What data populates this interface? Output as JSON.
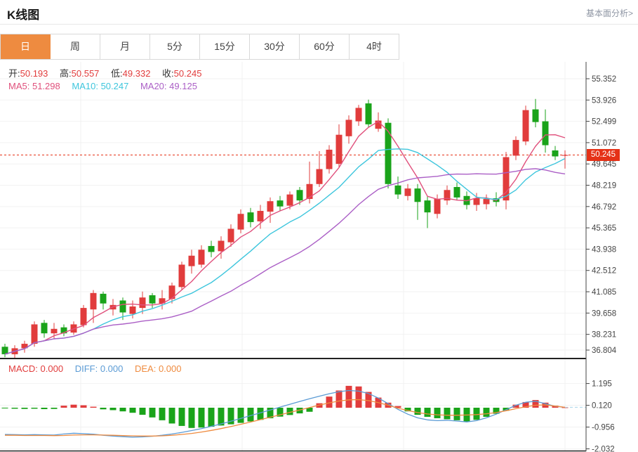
{
  "header": {
    "title": "K线图",
    "link": "基本面分析>"
  },
  "tabs": {
    "items": [
      "日",
      "周",
      "月",
      "5分",
      "15分",
      "30分",
      "60分",
      "4时"
    ],
    "active_index": 0
  },
  "legend": {
    "ohlc": [
      {
        "label": "开:",
        "value": "50.193"
      },
      {
        "label": "高:",
        "value": "50.557"
      },
      {
        "label": "低:",
        "value": "49.332"
      },
      {
        "label": "收:",
        "value": "50.245"
      }
    ],
    "ma": [
      {
        "label": "MA5:",
        "value": "51.298",
        "color": "#e0507c"
      },
      {
        "label": "MA10:",
        "value": "50.247",
        "color": "#3ec6dd"
      },
      {
        "label": "MA20:",
        "value": "49.125",
        "color": "#ab5fc6"
      }
    ],
    "macd": [
      {
        "label": "MACD:",
        "value": "0.000",
        "color": "#e13c3c"
      },
      {
        "label": "DIFF:",
        "value": "0.000",
        "color": "#5b9bd5"
      },
      {
        "label": "DEA:",
        "value": "0.000",
        "color": "#ef8b3f"
      }
    ]
  },
  "colors": {
    "accent": "#ee8b40",
    "up": "#e13c3c",
    "down": "#1aa31a",
    "ma5": "#e0507c",
    "ma10": "#3ec6dd",
    "ma20": "#ab5fc6",
    "diff": "#5b9bd5",
    "dea": "#ef8b3f",
    "last_price_bg": "#e53117",
    "dotted_line": "#e53117",
    "grid": "#f0f0f0",
    "axis": "#444444",
    "pane_divider": "#222222",
    "tick_text": "#444444"
  },
  "chart_data": {
    "type": "candlestick",
    "title": "K线图",
    "panes": [
      "price-with-ma",
      "macd"
    ],
    "legend_position": "top-left",
    "grid": true,
    "main": {
      "y_ticks": [
        "55.352",
        "53.926",
        "52.499",
        "51.072",
        "49.645",
        "48.219",
        "46.792",
        "45.365",
        "43.938",
        "42.512",
        "41.085",
        "39.658",
        "38.231",
        "36.804"
      ],
      "ylim": [
        36.6,
        55.4
      ],
      "last_price": 50.245,
      "last_price_label": "50.245",
      "ma_periods": [
        5,
        10,
        20
      ],
      "candles_format": [
        "open",
        "high",
        "low",
        "close"
      ],
      "candles": [
        [
          37.4,
          37.6,
          36.7,
          36.9
        ],
        [
          36.9,
          37.5,
          36.65,
          37.3
        ],
        [
          37.3,
          37.8,
          37.0,
          37.6
        ],
        [
          37.6,
          39.1,
          37.4,
          38.9
        ],
        [
          39.0,
          39.2,
          38.0,
          38.3
        ],
        [
          38.3,
          39.0,
          37.9,
          38.6
        ],
        [
          38.7,
          38.9,
          38.1,
          38.3
        ],
        [
          38.35,
          39.1,
          38.2,
          38.9
        ],
        [
          38.85,
          40.2,
          38.7,
          40.0
        ],
        [
          39.9,
          41.2,
          39.0,
          41.0
        ],
        [
          40.95,
          41.1,
          39.9,
          40.3
        ],
        [
          39.9,
          40.6,
          39.5,
          40.2
        ],
        [
          40.5,
          40.7,
          39.2,
          39.7
        ],
        [
          39.6,
          40.5,
          39.3,
          40.1
        ],
        [
          40.0,
          41.1,
          39.6,
          40.7
        ],
        [
          40.85,
          41.0,
          40.0,
          40.3
        ],
        [
          40.3,
          41.2,
          39.9,
          40.65
        ],
        [
          40.6,
          41.7,
          40.3,
          41.5
        ],
        [
          41.4,
          43.1,
          41.2,
          42.9
        ],
        [
          42.8,
          43.9,
          42.3,
          43.5
        ],
        [
          42.9,
          44.2,
          42.7,
          43.9
        ],
        [
          44.15,
          44.5,
          43.4,
          43.75
        ],
        [
          43.8,
          44.8,
          43.3,
          44.5
        ],
        [
          44.4,
          45.6,
          44.1,
          45.3
        ],
        [
          45.25,
          46.6,
          45.0,
          46.3
        ],
        [
          46.4,
          46.7,
          45.4,
          45.75
        ],
        [
          45.8,
          46.9,
          45.3,
          46.5
        ],
        [
          46.45,
          47.4,
          45.7,
          47.15
        ],
        [
          47.2,
          47.5,
          46.5,
          46.8
        ],
        [
          46.85,
          47.8,
          46.6,
          47.6
        ],
        [
          47.9,
          48.1,
          46.9,
          47.2
        ],
        [
          47.3,
          49.8,
          47.0,
          48.3
        ],
        [
          48.3,
          50.5,
          48.1,
          49.3
        ],
        [
          49.3,
          50.9,
          49.0,
          50.6
        ],
        [
          49.65,
          52.3,
          49.4,
          51.6
        ],
        [
          51.5,
          52.9,
          51.0,
          52.6
        ],
        [
          52.5,
          53.6,
          52.2,
          53.4
        ],
        [
          53.7,
          53.95,
          52.1,
          52.3
        ],
        [
          52.0,
          53.1,
          51.8,
          52.55
        ],
        [
          52.4,
          52.7,
          48.0,
          48.3
        ],
        [
          48.2,
          48.8,
          47.3,
          47.6
        ],
        [
          47.5,
          48.3,
          47.2,
          48.0
        ],
        [
          48.0,
          48.3,
          45.9,
          47.1
        ],
        [
          47.2,
          47.5,
          45.35,
          46.4
        ],
        [
          46.3,
          47.6,
          46.0,
          47.3
        ],
        [
          47.2,
          48.2,
          46.9,
          47.9
        ],
        [
          48.1,
          48.4,
          47.2,
          47.4
        ],
        [
          47.5,
          47.8,
          46.6,
          46.9
        ],
        [
          46.9,
          47.7,
          46.5,
          47.35
        ],
        [
          46.95,
          47.6,
          46.6,
          47.3
        ],
        [
          47.35,
          47.75,
          46.8,
          47.1
        ],
        [
          47.2,
          50.45,
          46.6,
          50.1
        ],
        [
          50.2,
          51.5,
          49.9,
          51.25
        ],
        [
          51.15,
          53.55,
          50.9,
          53.25
        ],
        [
          53.3,
          54.0,
          52.1,
          52.45
        ],
        [
          52.5,
          53.3,
          50.4,
          50.9
        ],
        [
          50.55,
          50.85,
          49.9,
          50.15
        ],
        [
          50.193,
          50.557,
          49.332,
          50.245
        ]
      ]
    },
    "macd": {
      "y_ticks": [
        "1.195",
        "0.120",
        "-0.956",
        "-2.032"
      ],
      "ylim": [
        -2.2,
        1.4
      ],
      "hist": [
        -0.03,
        -0.05,
        -0.06,
        -0.05,
        -0.07,
        -0.06,
        0.1,
        0.15,
        0.12,
        0.05,
        -0.08,
        -0.12,
        -0.18,
        -0.25,
        -0.35,
        -0.48,
        -0.62,
        -0.78,
        -0.9,
        -1.0,
        -0.98,
        -0.94,
        -0.88,
        -0.82,
        -0.75,
        -0.68,
        -0.6,
        -0.52,
        -0.44,
        -0.36,
        -0.28,
        -0.2,
        0.22,
        0.55,
        0.85,
        1.08,
        1.05,
        0.78,
        0.5,
        0.25,
        0.08,
        -0.18,
        -0.35,
        -0.45,
        -0.52,
        -0.57,
        -0.62,
        -0.68,
        -0.6,
        -0.45,
        -0.3,
        -0.15,
        0.15,
        0.28,
        0.38,
        0.25,
        0.1,
        0.02
      ],
      "diff": [
        -1.32,
        -1.33,
        -1.34,
        -1.33,
        -1.34,
        -1.35,
        -1.3,
        -1.26,
        -1.28,
        -1.31,
        -1.36,
        -1.4,
        -1.43,
        -1.45,
        -1.44,
        -1.41,
        -1.36,
        -1.3,
        -1.22,
        -1.13,
        -1.03,
        -0.92,
        -0.8,
        -0.67,
        -0.53,
        -0.39,
        -0.25,
        -0.11,
        0.03,
        0.17,
        0.31,
        0.44,
        0.57,
        0.69,
        0.79,
        0.85,
        0.82,
        0.7,
        0.48,
        0.2,
        -0.08,
        -0.32,
        -0.5,
        -0.6,
        -0.64,
        -0.62,
        -0.66,
        -0.7,
        -0.64,
        -0.5,
        -0.32,
        -0.1,
        0.12,
        0.27,
        0.32,
        0.2,
        0.07,
        0.02
      ],
      "dea": [
        -1.36,
        -1.36,
        -1.37,
        -1.37,
        -1.37,
        -1.38,
        -1.37,
        -1.35,
        -1.34,
        -1.34,
        -1.35,
        -1.36,
        -1.38,
        -1.39,
        -1.4,
        -1.4,
        -1.39,
        -1.36,
        -1.32,
        -1.27,
        -1.2,
        -1.12,
        -1.03,
        -0.93,
        -0.82,
        -0.71,
        -0.59,
        -0.47,
        -0.35,
        -0.23,
        -0.11,
        0.01,
        0.13,
        0.24,
        0.33,
        0.39,
        0.4,
        0.35,
        0.25,
        0.12,
        -0.02,
        -0.14,
        -0.24,
        -0.31,
        -0.35,
        -0.37,
        -0.37,
        -0.36,
        -0.34,
        -0.3,
        -0.24,
        -0.15,
        -0.05,
        0.05,
        0.12,
        0.14,
        0.08,
        0.02
      ]
    }
  }
}
